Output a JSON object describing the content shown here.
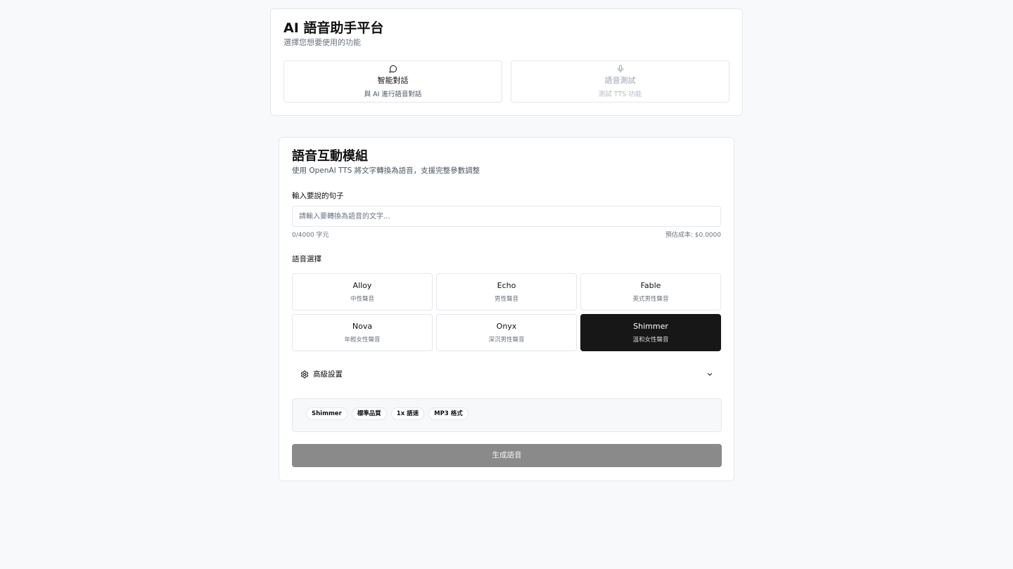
{
  "app": {
    "title": "AI 語音助手平台",
    "subtitle": "選擇您想要使用的功能"
  },
  "modes": [
    {
      "title": "智能對話",
      "description": "與 AI 進行語音對話",
      "icon": "chat-bubble-icon",
      "active": true
    },
    {
      "title": "語音測試",
      "description": "測試 TTS 功能",
      "icon": "microphone-icon",
      "active": false
    }
  ],
  "module": {
    "title": "語音互動模組",
    "subtitle": "使用 OpenAI TTS 將文字轉換為語音，支援完整參數調整"
  },
  "input": {
    "label": "輸入要說的句子",
    "placeholder": "請輸入要轉換為語音的文字...",
    "value": "",
    "char_count": "0/4000 字元",
    "cost": "預估成本: $0.0000"
  },
  "voices": {
    "label": "語音選擇",
    "selected": "Shimmer",
    "items": [
      {
        "name": "Alloy",
        "description": "中性聲音"
      },
      {
        "name": "Echo",
        "description": "男性聲音"
      },
      {
        "name": "Fable",
        "description": "英式男性聲音"
      },
      {
        "name": "Nova",
        "description": "年輕女性聲音"
      },
      {
        "name": "Onyx",
        "description": "深沉男性聲音"
      },
      {
        "name": "Shimmer",
        "description": "溫和女性聲音"
      }
    ]
  },
  "advanced": {
    "label": "高級設置",
    "icon": "gear-icon",
    "toggle_icon": "chevron-down-icon",
    "expanded": false
  },
  "summary": {
    "chips": [
      "Shimmer",
      "標準品質",
      "1x 語速",
      "MP3 格式"
    ]
  },
  "generate": {
    "label": "生成語音",
    "enabled": false
  },
  "colors": {
    "selected_card": "#171717",
    "generate_disabled": "#8a8a8a",
    "border": "#e5e7eb",
    "page_background": "#f8f9fb"
  }
}
